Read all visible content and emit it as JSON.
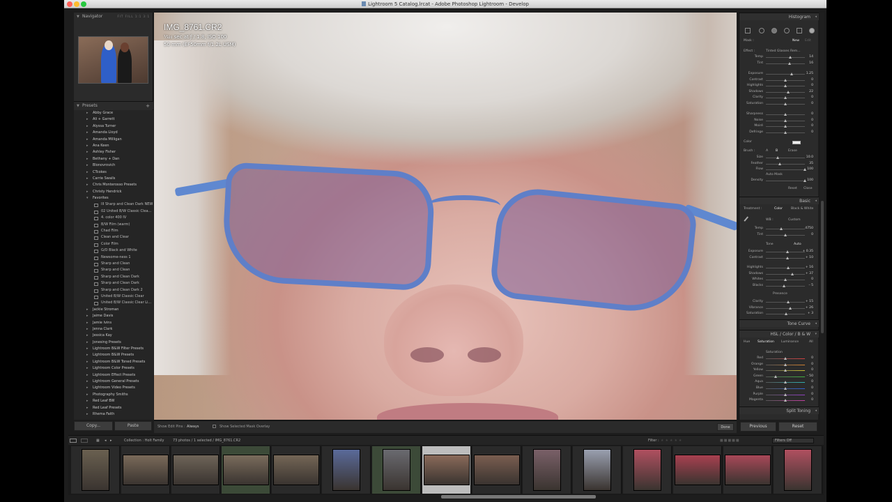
{
  "window": {
    "title": "Lightroom 5 Catalog.lrcat - Adobe Photoshop Lightroom - Develop",
    "traffic_colors": [
      "#ff5f57",
      "#febc2e",
      "#28c840"
    ]
  },
  "left_panel": {
    "navigator_title": "Navigator",
    "navigator_options": "FIT FILL 1:1 3:1",
    "presets_title": "Presets",
    "presets_add": "+",
    "presets": [
      {
        "label": "Abby Grace",
        "type": "folder"
      },
      {
        "label": "Ali + Garrett",
        "type": "folder"
      },
      {
        "label": "Alyssa Turner",
        "type": "folder"
      },
      {
        "label": "Amanda Lloyd",
        "type": "folder"
      },
      {
        "label": "Amanda Milligan",
        "type": "folder"
      },
      {
        "label": "Ana Keen",
        "type": "folder"
      },
      {
        "label": "Ashley Fisher",
        "type": "folder"
      },
      {
        "label": "Bethany + Dan",
        "type": "folder"
      },
      {
        "label": "Blonovrovich",
        "type": "folder"
      },
      {
        "label": "CTcokes",
        "type": "folder"
      },
      {
        "label": "Carrie Swails",
        "type": "folder"
      },
      {
        "label": "Chris Monterosso Presets",
        "type": "folder"
      },
      {
        "label": "Christy Hendrick",
        "type": "folder"
      },
      {
        "label": "Favorites",
        "type": "folder-open"
      },
      {
        "label": "III Sharp and Clean Dark NEW",
        "type": "item"
      },
      {
        "label": "02 United B/W Classic Clea...",
        "type": "item"
      },
      {
        "label": "4. color 400 IV",
        "type": "item"
      },
      {
        "label": "B/W Film (warm)",
        "type": "item"
      },
      {
        "label": "Chad Film",
        "type": "item"
      },
      {
        "label": "Clean and Clear",
        "type": "item"
      },
      {
        "label": "Color Film",
        "type": "item"
      },
      {
        "label": "G/O Black and White",
        "type": "item"
      },
      {
        "label": "Newsome-ness 1",
        "type": "item"
      },
      {
        "label": "Sharp and Clean",
        "type": "item"
      },
      {
        "label": "Sharp and Clean",
        "type": "item"
      },
      {
        "label": "Sharp and Clean Dark",
        "type": "item"
      },
      {
        "label": "Sharp and Clean Dark",
        "type": "item"
      },
      {
        "label": "Sharp and Clean Dark 2",
        "type": "item"
      },
      {
        "label": "United B/W Classic Clear",
        "type": "item"
      },
      {
        "label": "United B/W Classic Clear Li...",
        "type": "item"
      },
      {
        "label": "Jackie Stroman",
        "type": "folder"
      },
      {
        "label": "Jaime Davis",
        "type": "folder"
      },
      {
        "label": "Jamie Ivins",
        "type": "folder"
      },
      {
        "label": "Jenna Clark",
        "type": "folder"
      },
      {
        "label": "Jessica Kay",
        "type": "folder"
      },
      {
        "label": "Jonesing Presets",
        "type": "folder"
      },
      {
        "label": "Lightroom B&W Filter Presets",
        "type": "folder"
      },
      {
        "label": "Lightroom B&W Presets",
        "type": "folder"
      },
      {
        "label": "Lightroom B&W Toned Presets",
        "type": "folder"
      },
      {
        "label": "Lightroom Color Presets",
        "type": "folder"
      },
      {
        "label": "Lightroom Effect Presets",
        "type": "folder"
      },
      {
        "label": "Lightroom General Presets",
        "type": "folder"
      },
      {
        "label": "Lightroom Video Presets",
        "type": "folder"
      },
      {
        "label": "Photography Smiths",
        "type": "folder"
      },
      {
        "label": "Red Leaf BW",
        "type": "folder"
      },
      {
        "label": "Red Leaf Presets",
        "type": "folder"
      },
      {
        "label": "Rhema Faith",
        "type": "folder"
      }
    ],
    "copy_label": "Copy...",
    "paste_label": "Paste"
  },
  "image": {
    "filename": "IMG_8761.CR2",
    "exposure_line": "¹⁄₃₂₀ sec at ƒ / 1.8, ISO 100",
    "lens_line": "50 mm (EF50mm f/1.2L USM)"
  },
  "toolbar": {
    "show_edit_pins_label": "Show Edit Pins :",
    "show_edit_pins_value": "Always",
    "show_mask_overlay": "Show Selected Mask Overlay",
    "done_label": "Done"
  },
  "right_panel": {
    "histogram_title": "Histogram",
    "mask_label": "Mask :",
    "mask_new": "New",
    "mask_edit": "Edit",
    "effect_label": "Effect :",
    "effect_value": "Tinted Glasses Rem...",
    "brush_sliders": [
      {
        "label": "Temp",
        "value": "14",
        "pos": 0.62
      },
      {
        "label": "Tint",
        "value": "16",
        "pos": 0.6
      },
      {
        "label": "Exposure",
        "value": "1.25",
        "pos": 0.66
      },
      {
        "label": "Contrast",
        "value": "0",
        "pos": 0.5
      },
      {
        "label": "Highlights",
        "value": "0",
        "pos": 0.5
      },
      {
        "label": "Shadows",
        "value": "22",
        "pos": 0.58
      },
      {
        "label": "Clarity",
        "value": "0",
        "pos": 0.5
      },
      {
        "label": "Saturation",
        "value": "0",
        "pos": 0.5
      },
      {
        "label": "Sharpness",
        "value": "0",
        "pos": 0.5
      },
      {
        "label": "Noise",
        "value": "0",
        "pos": 0.5
      },
      {
        "label": "Moiré",
        "value": "0",
        "pos": 0.5
      },
      {
        "label": "Defringe",
        "value": "0",
        "pos": 0.5
      }
    ],
    "color_label": "Color",
    "brush_label": "Brush :",
    "brush_a": "A",
    "brush_b": "B",
    "brush_erase": "Erase",
    "brush_params": [
      {
        "label": "Size",
        "value": "10.0",
        "pos": 0.3
      },
      {
        "label": "Feather",
        "value": "35",
        "pos": 0.35
      },
      {
        "label": "Flow",
        "value": "100",
        "pos": 1.0
      }
    ],
    "auto_mask_label": "Auto Mask",
    "density": {
      "label": "Density",
      "value": "100",
      "pos": 1.0
    },
    "brush_reset": "Reset",
    "brush_close": "Close",
    "basic_title": "Basic",
    "treatment_label": "Treatment :",
    "treatment_color": "Color",
    "treatment_bw": "Black & White",
    "wb_label": "WB :",
    "wb_value": "Custom",
    "wb_sliders": [
      {
        "label": "Temp",
        "value": "4750",
        "pos": 0.4
      },
      {
        "label": "Tint",
        "value": "0",
        "pos": 0.5
      }
    ],
    "tone_label": "Tone",
    "tone_auto": "Auto",
    "tone_sliders": [
      {
        "label": "Exposure",
        "value": "+ 0.35",
        "pos": 0.56
      },
      {
        "label": "Contrast",
        "value": "+ 10",
        "pos": 0.55
      }
    ],
    "tone_sliders2": [
      {
        "label": "Highlights",
        "value": "+ 16",
        "pos": 0.58
      },
      {
        "label": "Shadows",
        "value": "+ 37",
        "pos": 0.68
      },
      {
        "label": "Whites",
        "value": "0",
        "pos": 0.5
      },
      {
        "label": "Blacks",
        "value": "– 5",
        "pos": 0.47
      }
    ],
    "presence_label": "Presence",
    "presence_sliders": [
      {
        "label": "Clarity",
        "value": "+ 15",
        "pos": 0.58
      },
      {
        "label": "Vibrance",
        "value": "+ 26",
        "pos": 0.63
      },
      {
        "label": "Saturation",
        "value": "+ 3",
        "pos": 0.52
      }
    ],
    "tone_curve_title": "Tone Curve",
    "hsl_title": "HSL / Color / B & W",
    "hsl_tabs": [
      "Hue",
      "Saturation",
      "Luminance",
      "All"
    ],
    "hsl_section": "Saturation",
    "hsl_sliders": [
      {
        "label": "Red",
        "value": "0",
        "pos": 0.5,
        "color": "#d04040"
      },
      {
        "label": "Orange",
        "value": "0",
        "pos": 0.5,
        "color": "#d08030"
      },
      {
        "label": "Yellow",
        "value": "0",
        "pos": 0.5,
        "color": "#c8c030"
      },
      {
        "label": "Green",
        "value": "– 50",
        "pos": 0.25,
        "color": "#40b040"
      },
      {
        "label": "Aqua",
        "value": "0",
        "pos": 0.5,
        "color": "#30b0b0"
      },
      {
        "label": "Blue",
        "value": "0",
        "pos": 0.5,
        "color": "#3060d0"
      },
      {
        "label": "Purple",
        "value": "0",
        "pos": 0.5,
        "color": "#9040c0"
      },
      {
        "label": "Magenta",
        "value": "0",
        "pos": 0.5,
        "color": "#c040a0"
      }
    ],
    "split_toning_title": "Split Toning",
    "previous_label": "Previous",
    "reset_label": "Reset"
  },
  "filmstrip_bar": {
    "collection": "Collection : Holt Family",
    "count": "73 photos / 1 selected / IMG_8761.CR2",
    "filter_label": "Filter :",
    "filters_off": "Filters Off"
  },
  "filmstrip": [
    {
      "state": "normal",
      "w": 40,
      "h": 60,
      "tone": "#6a6050"
    },
    {
      "state": "normal",
      "w": 66,
      "h": 44,
      "tone": "#7a6a5a"
    },
    {
      "state": "normal",
      "w": 66,
      "h": 44,
      "tone": "#6e6458"
    },
    {
      "state": "green",
      "w": 66,
      "h": 44,
      "tone": "#7a6c5c"
    },
    {
      "state": "normal",
      "w": 66,
      "h": 44,
      "tone": "#746656"
    },
    {
      "state": "normal",
      "w": 40,
      "h": 60,
      "tone": "#5a6a9a"
    },
    {
      "state": "green",
      "w": 40,
      "h": 60,
      "tone": "#6a6a70"
    },
    {
      "state": "selected",
      "w": 66,
      "h": 44,
      "tone": "#8a6a5a"
    },
    {
      "state": "normal",
      "w": 66,
      "h": 44,
      "tone": "#7a5e50"
    },
    {
      "state": "normal",
      "w": 40,
      "h": 60,
      "tone": "#7a6068"
    },
    {
      "state": "normal",
      "w": 40,
      "h": 60,
      "tone": "#9aa0b0"
    },
    {
      "state": "normal",
      "w": 40,
      "h": 60,
      "tone": "#b05060"
    },
    {
      "state": "normal",
      "w": 66,
      "h": 44,
      "tone": "#a84050"
    },
    {
      "state": "normal",
      "w": 66,
      "h": 44,
      "tone": "#a84858"
    },
    {
      "state": "normal",
      "w": 40,
      "h": 60,
      "tone": "#b05060"
    }
  ]
}
